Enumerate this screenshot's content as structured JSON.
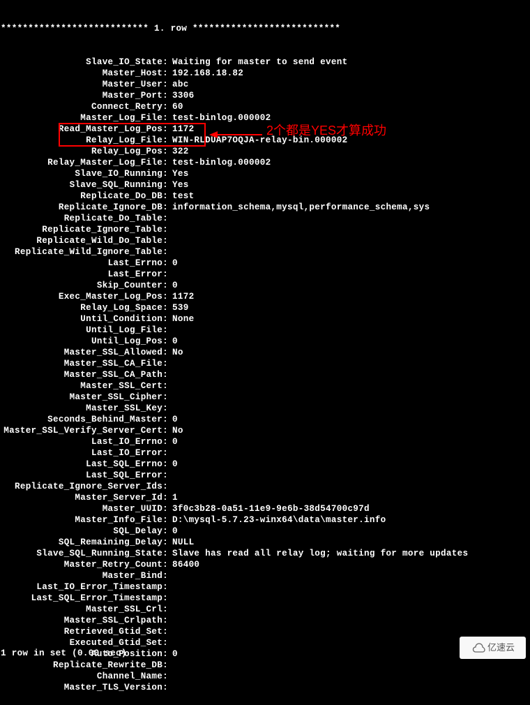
{
  "header": "*************************** 1. row ***************************",
  "fields": [
    {
      "label": "Slave_IO_State",
      "value": "Waiting for master to send event"
    },
    {
      "label": "Master_Host",
      "value": "192.168.18.82"
    },
    {
      "label": "Master_User",
      "value": "abc"
    },
    {
      "label": "Master_Port",
      "value": "3306"
    },
    {
      "label": "Connect_Retry",
      "value": "60"
    },
    {
      "label": "Master_Log_File",
      "value": "test-binlog.000002"
    },
    {
      "label": "Read_Master_Log_Pos",
      "value": "1172"
    },
    {
      "label": "Relay_Log_File",
      "value": "WIN-RLDUAP7OQJA-relay-bin.000002"
    },
    {
      "label": "Relay_Log_Pos",
      "value": "322"
    },
    {
      "label": "Relay_Master_Log_File",
      "value": "test-binlog.000002"
    },
    {
      "label": "Slave_IO_Running",
      "value": "Yes"
    },
    {
      "label": "Slave_SQL_Running",
      "value": "Yes"
    },
    {
      "label": "Replicate_Do_DB",
      "value": "test"
    },
    {
      "label": "Replicate_Ignore_DB",
      "value": "information_schema,mysql,performance_schema,sys"
    },
    {
      "label": "Replicate_Do_Table",
      "value": ""
    },
    {
      "label": "Replicate_Ignore_Table",
      "value": ""
    },
    {
      "label": "Replicate_Wild_Do_Table",
      "value": ""
    },
    {
      "label": "Replicate_Wild_Ignore_Table",
      "value": ""
    },
    {
      "label": "Last_Errno",
      "value": "0"
    },
    {
      "label": "Last_Error",
      "value": ""
    },
    {
      "label": "Skip_Counter",
      "value": "0"
    },
    {
      "label": "Exec_Master_Log_Pos",
      "value": "1172"
    },
    {
      "label": "Relay_Log_Space",
      "value": "539"
    },
    {
      "label": "Until_Condition",
      "value": "None"
    },
    {
      "label": "Until_Log_File",
      "value": ""
    },
    {
      "label": "Until_Log_Pos",
      "value": "0"
    },
    {
      "label": "Master_SSL_Allowed",
      "value": "No"
    },
    {
      "label": "Master_SSL_CA_File",
      "value": ""
    },
    {
      "label": "Master_SSL_CA_Path",
      "value": ""
    },
    {
      "label": "Master_SSL_Cert",
      "value": ""
    },
    {
      "label": "Master_SSL_Cipher",
      "value": ""
    },
    {
      "label": "Master_SSL_Key",
      "value": ""
    },
    {
      "label": "Seconds_Behind_Master",
      "value": "0"
    },
    {
      "label": "Master_SSL_Verify_Server_Cert",
      "value": "No"
    },
    {
      "label": "Last_IO_Errno",
      "value": "0"
    },
    {
      "label": "Last_IO_Error",
      "value": ""
    },
    {
      "label": "Last_SQL_Errno",
      "value": "0"
    },
    {
      "label": "Last_SQL_Error",
      "value": ""
    },
    {
      "label": "Replicate_Ignore_Server_Ids",
      "value": ""
    },
    {
      "label": "Master_Server_Id",
      "value": "1"
    },
    {
      "label": "Master_UUID",
      "value": "3f0c3b28-0a51-11e9-9e6b-38d54700c97d"
    },
    {
      "label": "Master_Info_File",
      "value": "D:\\mysql-5.7.23-winx64\\data\\master.info"
    },
    {
      "label": "SQL_Delay",
      "value": "0"
    },
    {
      "label": "SQL_Remaining_Delay",
      "value": "NULL"
    },
    {
      "label": "Slave_SQL_Running_State",
      "value": "Slave has read all relay log; waiting for more updates"
    },
    {
      "label": "Master_Retry_Count",
      "value": "86400"
    },
    {
      "label": "Master_Bind",
      "value": ""
    },
    {
      "label": "Last_IO_Error_Timestamp",
      "value": ""
    },
    {
      "label": "Last_SQL_Error_Timestamp",
      "value": ""
    },
    {
      "label": "Master_SSL_Crl",
      "value": ""
    },
    {
      "label": "Master_SSL_Crlpath",
      "value": ""
    },
    {
      "label": "Retrieved_Gtid_Set",
      "value": ""
    },
    {
      "label": "Executed_Gtid_Set",
      "value": ""
    },
    {
      "label": "Auto_Position",
      "value": "0"
    },
    {
      "label": "Replicate_Rewrite_DB",
      "value": ""
    },
    {
      "label": "Channel_Name",
      "value": ""
    },
    {
      "label": "Master_TLS_Version",
      "value": ""
    }
  ],
  "footer": "1 row in set (0.00 sec)",
  "annotation_text": "2个都是YES才算成功",
  "watermark_text": "亿速云"
}
